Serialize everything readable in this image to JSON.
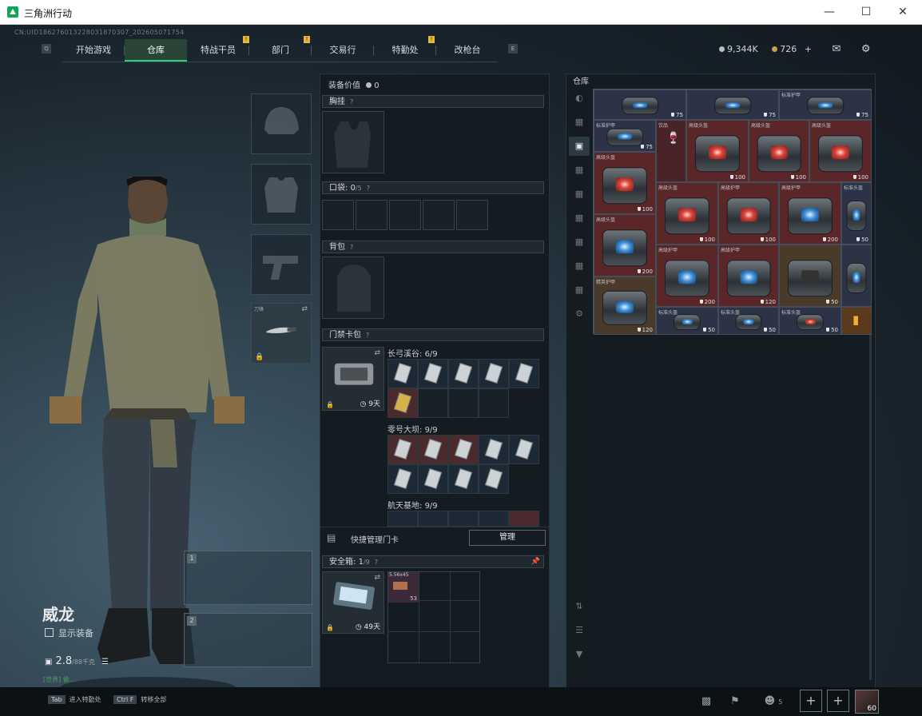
{
  "window": {
    "title": "三角洲行动"
  },
  "header": {
    "uid": "CN:UID18627601322803187030​7_202605071754",
    "key_left": "Q",
    "key_right": "E",
    "tabs": [
      "开始游戏",
      "仓库",
      "特战干员",
      "部门",
      "交易行",
      "特勤处",
      "改枪台"
    ],
    "active_tab": "仓库",
    "badge": "!",
    "currency_silver": "9,344K",
    "currency_gold": "726",
    "plus": "+"
  },
  "character": {
    "name": "威龙",
    "show_equipment_label": "显示装备",
    "weight": "2.8",
    "weight_max": "/88千克",
    "chat_preview": "[世界] 偷…",
    "weapon_slot_1": "1",
    "weapon_slot_2": "2",
    "melee_label": "刀锋"
  },
  "equipment": {
    "value_label": "装备价值",
    "value": "0",
    "chest_rig": "胸挂",
    "pockets": "口袋:",
    "pockets_count": "0",
    "pockets_max": "/5",
    "backpack": "背包",
    "keycard_bag": "门禁卡包",
    "help": "?",
    "keycard_time": "9天",
    "groups": [
      {
        "name": "长弓溪谷:",
        "count": "6/9"
      },
      {
        "name": "零号大坝:",
        "count": "9/9"
      },
      {
        "name": "航天基地:",
        "count": "9/9"
      }
    ],
    "quick_manage": "快捷管理门卡",
    "manage_button": "管理",
    "safe_box": "安全箱:",
    "safe_count": "1",
    "safe_max": "/9",
    "safe_time": "49天",
    "ammo_label": "5.56x45",
    "ammo_count": "53"
  },
  "warehouse": {
    "title": "仓库",
    "items": [
      {
        "label": "",
        "dur": "75",
        "color": "blue"
      },
      {
        "label": "",
        "dur": "75",
        "color": "blue"
      },
      {
        "label": "标准护甲",
        "dur": "75",
        "color": "blue"
      },
      {
        "label": "标准护甲",
        "dur": "75",
        "color": "blue"
      },
      {
        "label": "高级头盔",
        "dur": "100",
        "color": "red"
      },
      {
        "label": "高级头盔",
        "dur": "100",
        "color": "red"
      },
      {
        "label": "高级头盔",
        "dur": "100",
        "color": "red"
      },
      {
        "label": "高级头盔",
        "dur": "100",
        "color": "red"
      },
      {
        "label": "高级头盔",
        "dur": "100",
        "color": "red"
      },
      {
        "label": "高级护甲",
        "dur": "100",
        "color": "red"
      },
      {
        "label": "高级护甲",
        "dur": "200",
        "color": "blue"
      },
      {
        "label": "标准头盔",
        "dur": "50",
        "color": "blue"
      },
      {
        "label": "高级头盔",
        "dur": "200",
        "color": "blue"
      },
      {
        "label": "高级护甲",
        "dur": "200",
        "color": "blue"
      },
      {
        "label": "高级护甲",
        "dur": "120",
        "color": "blue"
      },
      {
        "label": "",
        "dur": "50",
        "color": "blue"
      },
      {
        "label": "精英护甲",
        "dur": "120",
        "color": "blue"
      },
      {
        "label": "标准头盔",
        "dur": "50",
        "color": "blue"
      },
      {
        "label": "标准头盔",
        "dur": "50",
        "color": "blue"
      },
      {
        "label": "标准头盔",
        "dur": "50",
        "color": "red"
      }
    ],
    "misc_label": "饮品"
  },
  "bottom": {
    "key1": "Tab",
    "key1_label": "进入特勤处",
    "key2": "Ctrl F",
    "key2_label": "转移全部",
    "friends_count": "5",
    "level": "60"
  }
}
